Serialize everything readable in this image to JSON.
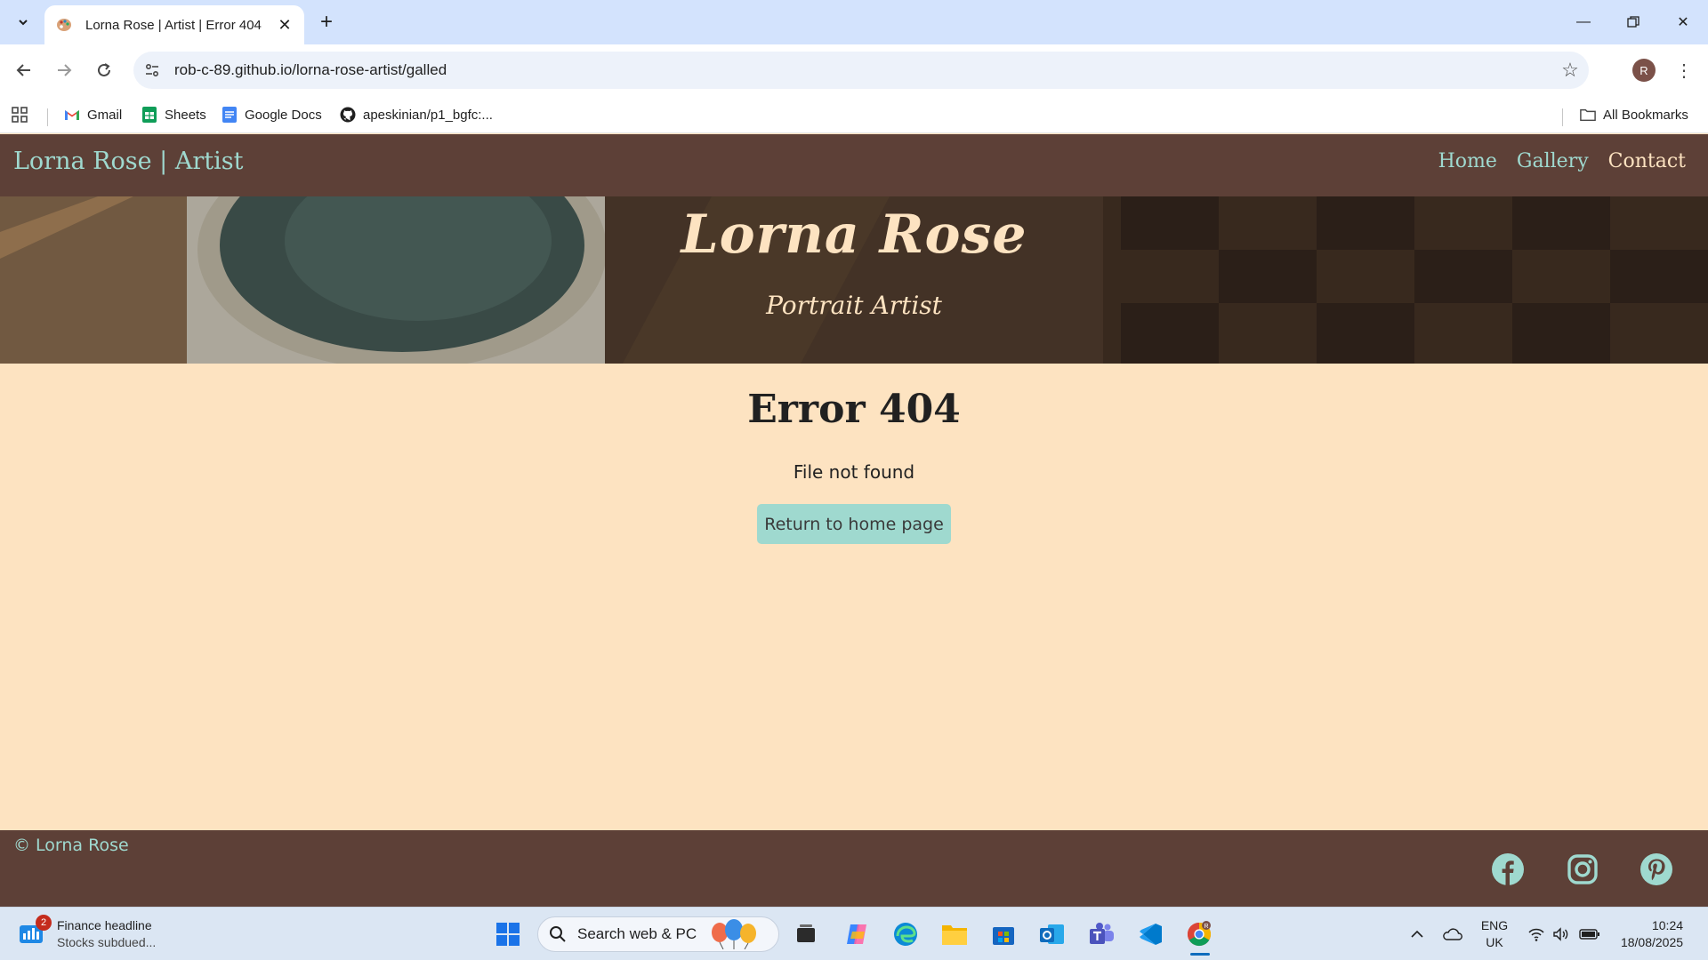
{
  "browser": {
    "tab_title": "Lorna Rose | Artist | Error 404",
    "url": "rob-c-89.github.io/lorna-rose-artist/galled",
    "profile_initial": "R",
    "bookmarks": [
      {
        "label": "Gmail"
      },
      {
        "label": "Sheets"
      },
      {
        "label": "Google Docs"
      },
      {
        "label": "apeskinian/p1_bgfc:..."
      }
    ],
    "all_bookmarks_label": "All Bookmarks"
  },
  "site": {
    "brand": "Lorna Rose | Artist",
    "nav": [
      {
        "label": "Home"
      },
      {
        "label": "Gallery"
      },
      {
        "label": "Contact"
      }
    ],
    "hero_title": "Lorna Rose",
    "hero_subtitle": "Portrait Artist",
    "error_title": "Error 404",
    "error_text": "File not found",
    "home_button": "Return to home page",
    "copyright": "© Lorna Rose",
    "social_icons": [
      "facebook-icon",
      "instagram-icon",
      "pinterest-icon"
    ],
    "colors": {
      "nav_bg": "#5d4037",
      "accent": "#9fd9cf",
      "page_bg": "#fde3c1"
    }
  },
  "taskbar": {
    "widget_badge": "2",
    "widget_title": "Finance headline",
    "widget_sub": "Stocks subdued...",
    "search_placeholder": "Search web & PC",
    "lang_line1": "ENG",
    "lang_line2": "UK",
    "time": "10:24",
    "date": "18/08/2025",
    "chrome_profile_badge": "R"
  }
}
